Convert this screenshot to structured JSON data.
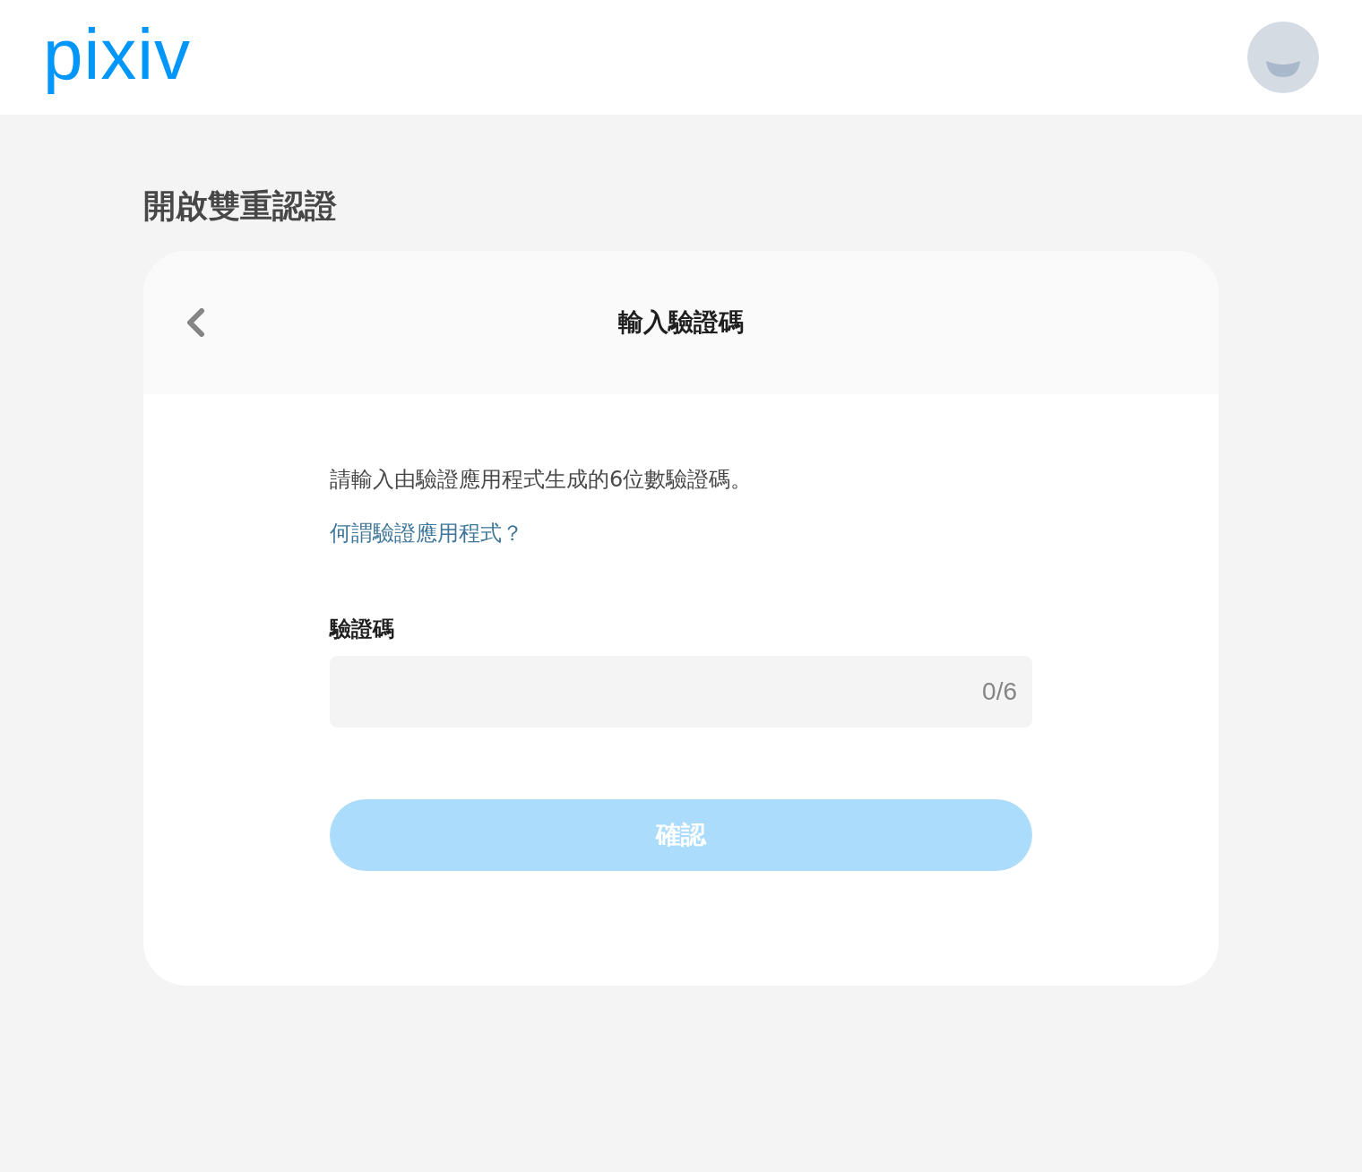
{
  "header": {
    "logo": "pixiv"
  },
  "page_title": "開啟雙重認證",
  "card": {
    "title": "輸入驗證碼",
    "description": "請輸入由驗證應用程式生成的6位數驗證碼。",
    "help_link": "何謂驗證應用程式？",
    "code_field": {
      "label": "驗證碼",
      "counter": "0/6"
    },
    "confirm_button": {
      "label": "確認",
      "disabled": true
    }
  }
}
